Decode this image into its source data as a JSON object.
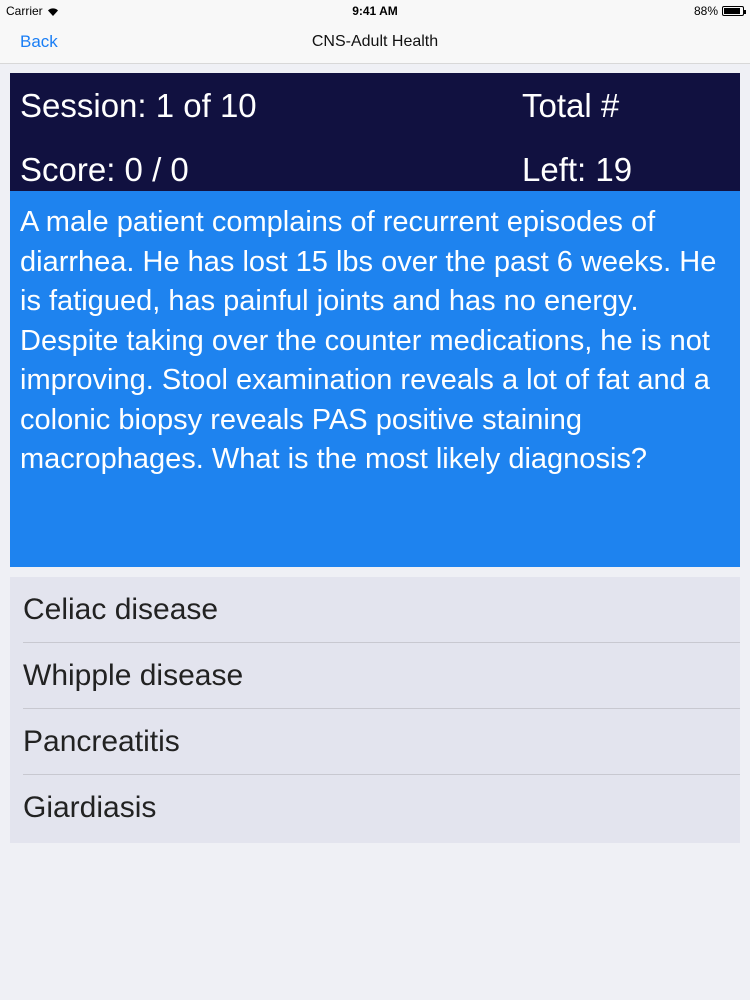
{
  "status_bar": {
    "carrier": "Carrier",
    "time": "9:41 AM",
    "battery": "88%",
    "battery_level": 0.88,
    "wifi_icon": "wifi-icon",
    "battery_icon": "battery-icon"
  },
  "nav": {
    "back_label": "Back",
    "title": "CNS-Adult Health"
  },
  "header": {
    "session": "Session: 1 of 10",
    "total": "Total #",
    "score": "Score: 0 / 0",
    "left": "Left: 19"
  },
  "question": {
    "text": "A male patient complains of recurrent episodes of diarrhea. He has lost 15 lbs over the past 6 weeks. He is fatigued, has painful joints and has no energy. Despite taking over the counter medications, he is not improving. Stool examination reveals a lot of fat and a colonic biopsy reveals PAS positive staining macrophages. What is the most likely diagnosis?"
  },
  "answers": [
    {
      "label": "Celiac disease"
    },
    {
      "label": "Whipple disease"
    },
    {
      "label": "Pancreatitis"
    },
    {
      "label": "Giardiasis"
    }
  ],
  "colors": {
    "accent": "#1a7ef5",
    "header_bg": "#111140",
    "question_bg": "#1e83ef",
    "answers_bg": "#e3e4ee"
  }
}
